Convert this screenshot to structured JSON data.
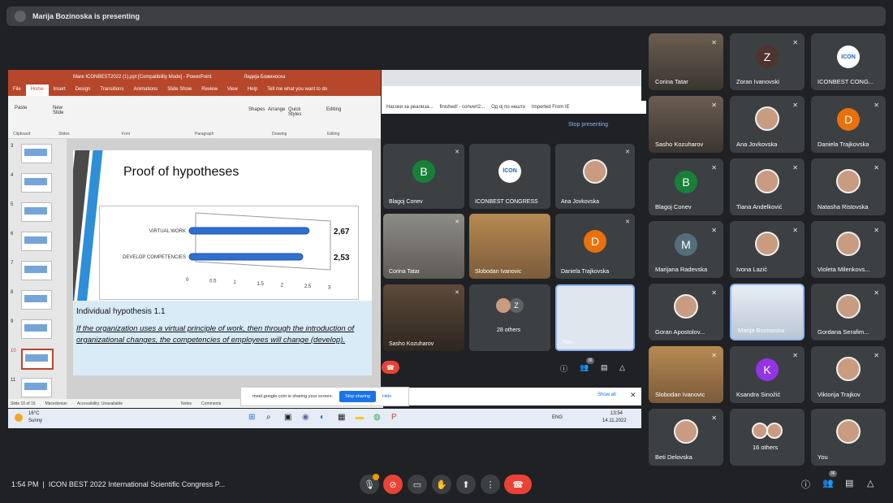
{
  "banner": {
    "text": "Marija Bozinoska is presenting"
  },
  "ppt": {
    "title": "Mare ICONBEST2022 (1).ppt [Compatibility Mode] - PowerPoint",
    "user": "Лидија Божинoска",
    "tell_me": "Tell me what you want to do",
    "tabs": [
      "File",
      "Home",
      "Insert",
      "Design",
      "Transitions",
      "Animations",
      "Slide Show",
      "Review",
      "View",
      "Help"
    ],
    "ribbon_groups": [
      "Clipboard",
      "Slides",
      "Font",
      "Paragraph",
      "Drawing",
      "Editing"
    ],
    "ribbon_buttons": {
      "paste": "Paste",
      "new_slide": "New Slide",
      "shapes": "Shapes",
      "arrange": "Arrange",
      "quick_styles": "Quick Styles",
      "editing": "Editing"
    },
    "slide_numbers": [
      "3",
      "4",
      "5",
      "6",
      "7",
      "8",
      "9",
      "10",
      "11"
    ],
    "slide_title": "Proof of hypotheses",
    "individual_heading": "Individual hypothesis 1.1",
    "hypothesis_text": "If the organization uses a virtual principle of work, then through the introduction of organizational changes, the competencies of employees will change (develop).",
    "status": {
      "slide": "Slide 10 of 15",
      "language": "Macedonian",
      "accessibility": "Accessibility: Unavailable",
      "notes": "Notes",
      "comments": "Comments"
    }
  },
  "chart_data": {
    "type": "bar",
    "orientation": "horizontal",
    "categories": [
      "VIRTUAL WORK",
      "DEVELOP COMPETENCIES"
    ],
    "values": [
      2.67,
      2.53
    ],
    "value_labels": [
      "2,67",
      "2,53"
    ],
    "xlim": [
      0,
      3
    ],
    "xticks": [
      "0",
      "0.5",
      "1",
      "1.5",
      "2",
      "2.5",
      "3"
    ],
    "grid": false
  },
  "browser": {
    "bookmarks": [
      "Насоки за реализа...",
      "finished! - convert2...",
      "Од ој по нешто",
      "Imported From IE"
    ],
    "stop_presenting": "Stop presenting",
    "show_all": "Show all"
  },
  "share_bar": {
    "text": "meet.google.com is sharing your screen.",
    "stop": "Stop sharing",
    "hide": "Hide"
  },
  "taskbar": {
    "temp": "16°C",
    "weather": "Sunny",
    "lang": "ENG",
    "time": "13:54",
    "date": "14.11.2022"
  },
  "inner_meet": {
    "tiles": [
      {
        "name": "Blagoj Conev",
        "initial": "B",
        "color": "#188038"
      },
      {
        "name": "ICONBEST CONGRESS",
        "initial": "",
        "color": "#ffffff"
      },
      {
        "name": "Ana Jovkovska",
        "initial": "",
        "color": "#c99b80"
      },
      {
        "name": "Corina Tatar",
        "initial": "",
        "color": ""
      },
      {
        "name": "Slobodan Ivanovic",
        "initial": "",
        "color": ""
      },
      {
        "name": "Daniela Trajkovska",
        "initial": "D",
        "color": "#e8710a"
      },
      {
        "name": "Sasho Kozuharov",
        "initial": "",
        "color": ""
      },
      {
        "name": "28 others",
        "initial": "Z",
        "color": "#5f6368"
      },
      {
        "name": "You",
        "initial": "",
        "color": ""
      }
    ],
    "count": "36"
  },
  "grid": {
    "tiles": [
      {
        "name": "Corina Tatar",
        "type": "photo",
        "initial": "",
        "color": ""
      },
      {
        "name": "Zoran Ivanovski",
        "type": "letter",
        "initial": "Z",
        "color": "#4e342e"
      },
      {
        "name": "ICONBEST CONG...",
        "type": "logo",
        "initial": "",
        "color": ""
      },
      {
        "name": "Sasho Kozuharov",
        "type": "photo",
        "initial": "",
        "color": ""
      },
      {
        "name": "Ana Jovkovska",
        "type": "face",
        "initial": "",
        "color": ""
      },
      {
        "name": "Daniela Trajkovska",
        "type": "letter",
        "initial": "D",
        "color": "#e8710a"
      },
      {
        "name": "Blagoj Conev",
        "type": "letter",
        "initial": "B",
        "color": "#188038"
      },
      {
        "name": "Tiana Andelković",
        "type": "face",
        "initial": "",
        "color": ""
      },
      {
        "name": "Natasha Ristovska",
        "type": "face",
        "initial": "",
        "color": ""
      },
      {
        "name": "Marijana Radevska",
        "type": "letter",
        "initial": "M",
        "color": "#546e7a"
      },
      {
        "name": "Ivona Lazić",
        "type": "face",
        "initial": "",
        "color": ""
      },
      {
        "name": "Violeta Milenkovs...",
        "type": "face",
        "initial": "",
        "color": ""
      },
      {
        "name": "Goran Apostolov...",
        "type": "face",
        "initial": "",
        "color": ""
      },
      {
        "name": "Marija Bozinoska",
        "type": "photo",
        "initial": "",
        "color": ""
      },
      {
        "name": "Gordana Serafim...",
        "type": "face",
        "initial": "",
        "color": ""
      },
      {
        "name": "Slobodan Ivanovic",
        "type": "photo",
        "initial": "",
        "color": ""
      },
      {
        "name": "Ksandra Sinožić",
        "type": "letter",
        "initial": "K",
        "color": "#9334e6"
      },
      {
        "name": "Viktorija Trajkov",
        "type": "face",
        "initial": "",
        "color": ""
      },
      {
        "name": "Beti Delovska",
        "type": "face",
        "initial": "",
        "color": ""
      },
      {
        "name": "16 others",
        "type": "others",
        "initial": "",
        "color": ""
      },
      {
        "name": "You",
        "type": "face",
        "initial": "",
        "color": ""
      }
    ]
  },
  "bottom": {
    "time": "1:54 PM",
    "meeting": "ICON BEST 2022 International Scientific Congress P...",
    "people_count": "36"
  }
}
